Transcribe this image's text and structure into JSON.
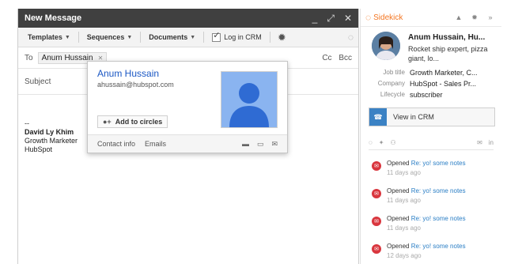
{
  "compose": {
    "title": "New Message",
    "window_buttons": [
      "_",
      "⤢",
      "✕"
    ],
    "toolbar": {
      "templates": "Templates",
      "sequences": "Sequences",
      "documents": "Documents",
      "log_in_crm": "Log in CRM"
    },
    "to_label": "To",
    "recipient": "Anum Hussain",
    "cc": "Cc",
    "bcc": "Bcc",
    "subject_label": "Subject",
    "signature": {
      "dashes": "--",
      "name": "David Ly Khim",
      "title": "Growth Marketer",
      "company": "HubSpot"
    }
  },
  "card": {
    "name": "Anum Hussain",
    "email": "ahussain@hubspot.com",
    "add_to_circles": "Add to circles",
    "contact_info": "Contact info",
    "emails": "Emails"
  },
  "sidekick": {
    "title": "Sidekick",
    "profile": {
      "name": "Anum Hussain, Hu...",
      "tagline": "Rocket ship expert, pizza giant, lo..."
    },
    "details": [
      {
        "label": "Job title",
        "value": "Growth Marketer, C..."
      },
      {
        "label": "Company",
        "value": "HubSpot - Sales Pr..."
      },
      {
        "label": "Lifecycle",
        "value": "subscriber"
      }
    ],
    "view_in_crm": "View in CRM",
    "activities": [
      {
        "verb": "Opened",
        "link": "Re: yo! some notes",
        "when": "11 days ago"
      },
      {
        "verb": "Opened",
        "link": "Re: yo! some notes",
        "when": "11 days ago"
      },
      {
        "verb": "Opened",
        "link": "Re: yo! some notes",
        "when": "11 days ago"
      },
      {
        "verb": "Opened",
        "link": "Re: yo! some notes",
        "when": "12 days ago"
      }
    ]
  }
}
